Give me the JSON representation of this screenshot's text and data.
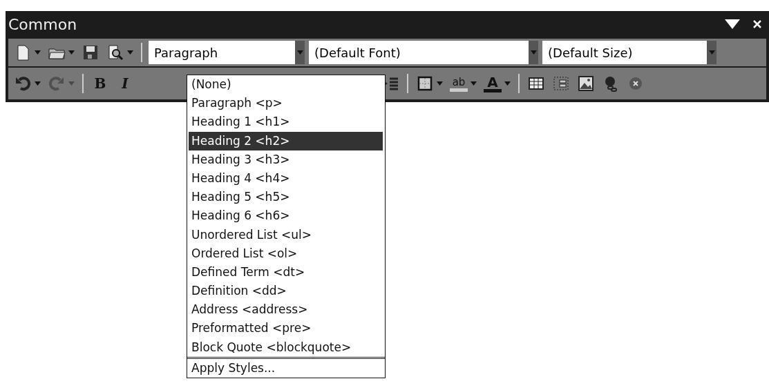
{
  "panel": {
    "title": "Common"
  },
  "toolbar_1": {
    "buttons": [
      {
        "kind": "new",
        "menu": true
      },
      {
        "kind": "open",
        "menu": true
      },
      {
        "kind": "save",
        "menu": false
      },
      {
        "kind": "preview",
        "menu": true
      }
    ],
    "combos": [
      {
        "value": "Paragraph"
      },
      {
        "value": "(Default Font)"
      },
      {
        "value": "(Default Size)"
      }
    ]
  },
  "toolbar_2": {
    "left": [
      {
        "kind": "undo",
        "menu": true,
        "disabled": false
      },
      {
        "kind": "redo",
        "menu": true,
        "disabled": true
      },
      {
        "kind": "bold",
        "label": "B",
        "menu": false,
        "disabled": false
      },
      {
        "kind": "italic",
        "label": "I",
        "menu": false,
        "disabled": false
      }
    ],
    "right": [
      {
        "kind": "indent",
        "menu": false,
        "disabled": false
      },
      {
        "kind": "border",
        "menu": true,
        "disabled": false
      },
      {
        "kind": "highlight",
        "label": "ab",
        "menu": true,
        "disabled": false
      },
      {
        "kind": "font-color",
        "label": "A",
        "menu": true,
        "disabled": false
      },
      {
        "kind": "table",
        "menu": false,
        "disabled": false
      },
      {
        "kind": "div",
        "menu": false,
        "disabled": false
      },
      {
        "kind": "image",
        "menu": false,
        "disabled": false
      },
      {
        "kind": "link",
        "menu": false,
        "disabled": false
      },
      {
        "kind": "remove",
        "menu": false,
        "disabled": false
      }
    ]
  },
  "style_menu": {
    "items": [
      {
        "label": "(None)",
        "selected": false
      },
      {
        "label": "Paragraph <p>",
        "selected": false
      },
      {
        "label": "Heading 1 <h1>",
        "selected": false
      },
      {
        "label": "Heading 2 <h2>",
        "selected": true
      },
      {
        "label": "Heading 3 <h3>",
        "selected": false
      },
      {
        "label": "Heading 4 <h4>",
        "selected": false
      },
      {
        "label": "Heading 5 <h5>",
        "selected": false
      },
      {
        "label": "Heading 6 <h6>",
        "selected": false
      },
      {
        "label": "Unordered List <ul>",
        "selected": false
      },
      {
        "label": "Ordered List <ol>",
        "selected": false
      },
      {
        "label": "Defined Term <dt>",
        "selected": false
      },
      {
        "label": "Definition <dd>",
        "selected": false
      },
      {
        "label": "Address <address>",
        "selected": false
      },
      {
        "label": "Preformatted <pre>",
        "selected": false
      },
      {
        "label": "Block Quote <blockquote>",
        "selected": false
      }
    ],
    "command": "Apply Styles..."
  }
}
